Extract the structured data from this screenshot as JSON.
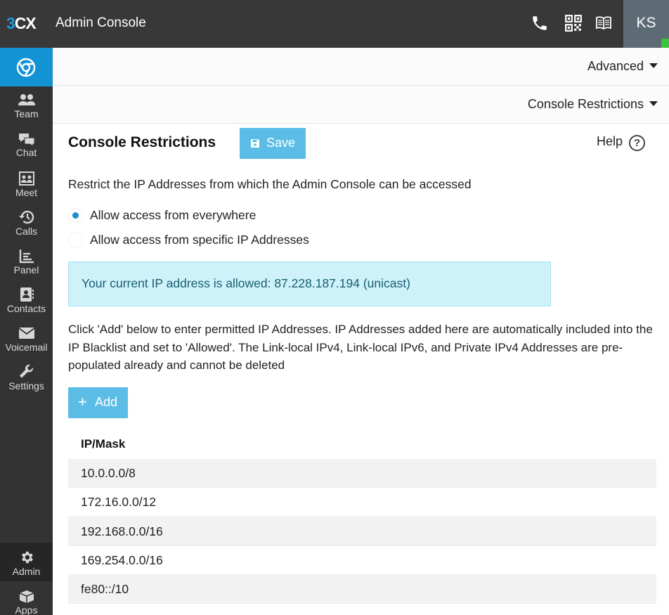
{
  "topbar": {
    "logo_num": "3",
    "logo_text": "CX",
    "title": "Admin Console",
    "avatar_initials": "KS",
    "icons": [
      "phone-icon",
      "qr-code-icon",
      "book-icon"
    ]
  },
  "sidebar": {
    "items": [
      {
        "label": "Team",
        "icon": "team-icon"
      },
      {
        "label": "Chat",
        "icon": "chat-icon"
      },
      {
        "label": "Meet",
        "icon": "meet-icon"
      },
      {
        "label": "Calls",
        "icon": "history-icon"
      },
      {
        "label": "Panel",
        "icon": "panel-chart-icon"
      },
      {
        "label": "Contacts",
        "icon": "contacts-icon"
      },
      {
        "label": "Voicemail",
        "icon": "envelope-icon"
      },
      {
        "label": "Settings",
        "icon": "wrench-icon"
      }
    ],
    "bottom": [
      {
        "label": "Admin",
        "icon": "gear-icon"
      },
      {
        "label": "Apps",
        "icon": "apps-box-icon"
      }
    ]
  },
  "nav": {
    "advanced": "Advanced",
    "section": "Console Restrictions"
  },
  "content": {
    "title": "Console Restrictions",
    "save_label": "Save",
    "help_label": "Help",
    "help_icon_glyph": "?",
    "description": "Restrict the IP Addresses from which the Admin Console can be accessed",
    "radio_everywhere": "Allow access from everywhere",
    "radio_specific": "Allow access from specific IP Addresses",
    "selected_option": "everywhere",
    "alert": "Your current IP address is allowed: 87.228.187.194 (unicast)",
    "info": "Click 'Add' below to enter permitted IP Addresses. IP Addresses added here are automatically included into the IP Blacklist and set to 'Allowed'. The Link-local IPv4, Link-local IPv6, and Private IPv4 Addresses are pre-populated already and cannot be deleted",
    "add_label": "Add",
    "add_glyph": "+"
  },
  "table": {
    "header": "IP/Mask",
    "rows": [
      "10.0.0.0/8",
      "172.16.0.0/12",
      "192.168.0.0/16",
      "169.254.0.0/16",
      "fe80::/10"
    ]
  },
  "colors": {
    "topbar": "#383838",
    "sidebar": "#333333",
    "accent": "#1393d3",
    "button": "#5bbde6",
    "alert_bg": "#cff1fa",
    "status_online": "#3cc23c"
  }
}
